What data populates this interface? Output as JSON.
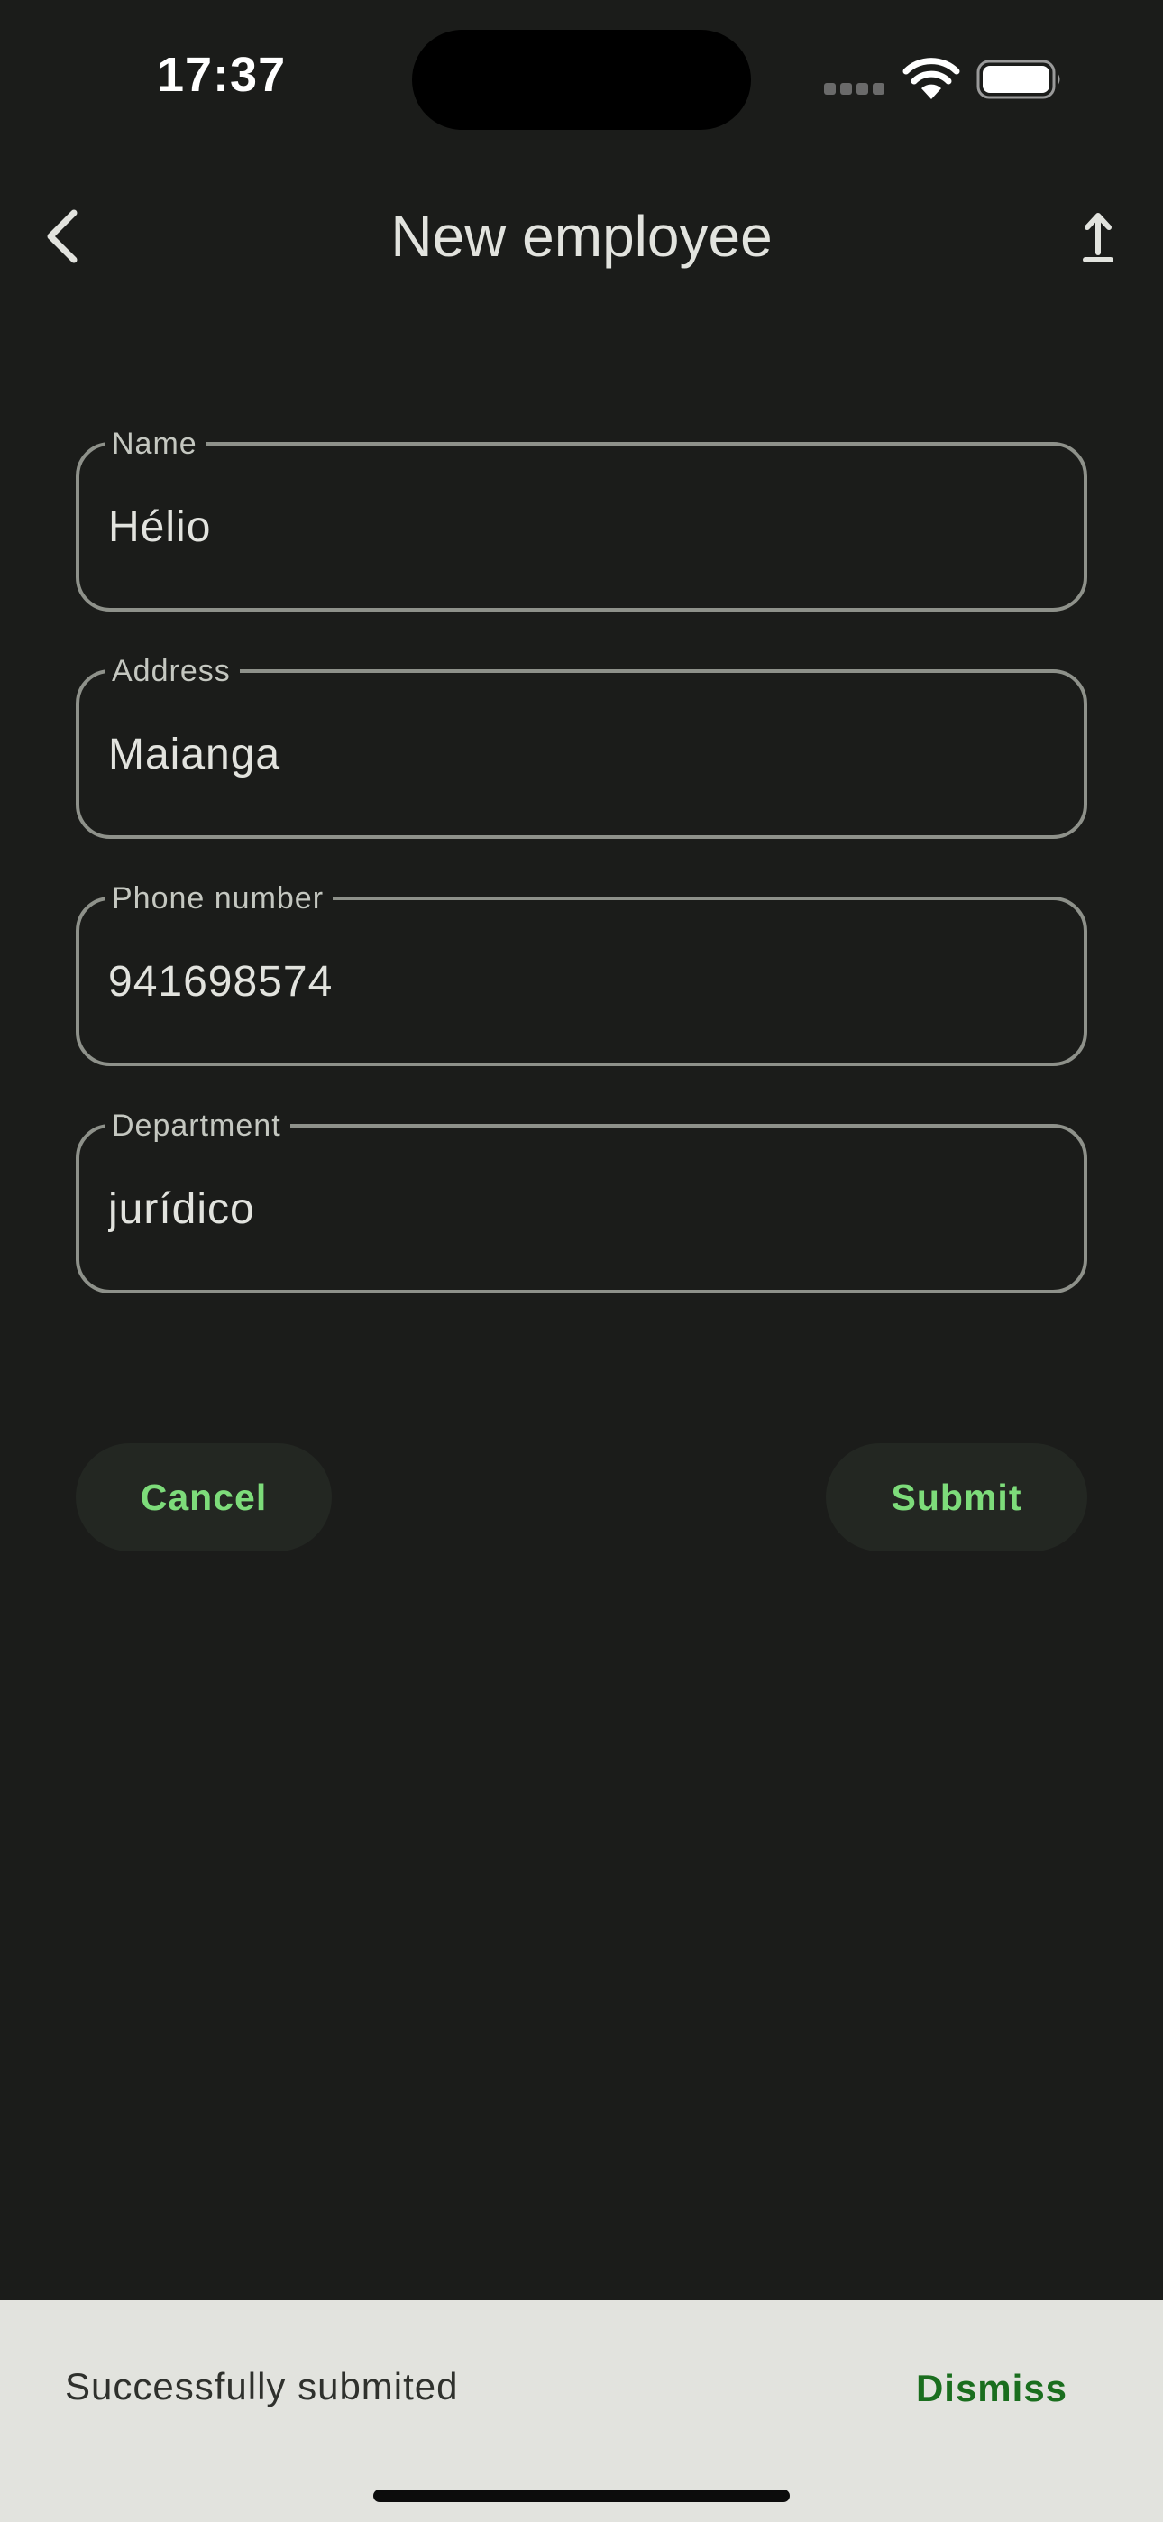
{
  "status_bar": {
    "time": "17:37",
    "signal_icon": "signal-dots-icon",
    "wifi_icon": "wifi-icon",
    "battery_icon": "battery-icon"
  },
  "app_bar": {
    "title": "New employee",
    "back_icon": "chevron-left-icon",
    "action_icon": "upload-icon"
  },
  "form": {
    "fields": [
      {
        "label": "Name",
        "value": "Hélio"
      },
      {
        "label": "Address",
        "value": "Maianga"
      },
      {
        "label": "Phone number",
        "value": "941698574"
      },
      {
        "label": "Department",
        "value": "jurídico"
      }
    ],
    "cancel_label": "Cancel",
    "submit_label": "Submit"
  },
  "snackbar": {
    "message": "Successfully submited",
    "action_label": "Dismiss"
  },
  "colors": {
    "background": "#1b1c1a",
    "field_border": "#8e918a",
    "button_text": "#7ddc7a",
    "snackbar_background": "#e2e3de",
    "snackbar_action": "#1a6e1e"
  }
}
